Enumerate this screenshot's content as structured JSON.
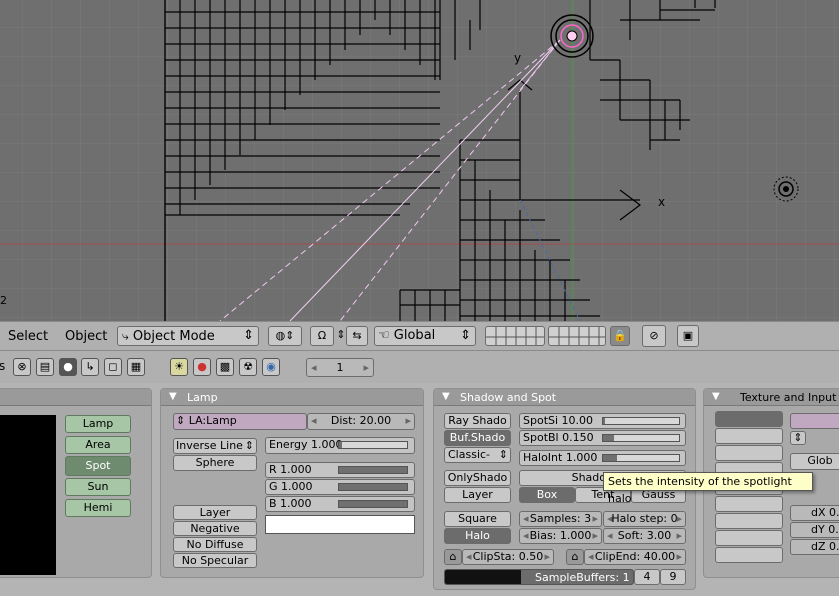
{
  "header": {
    "menus": [
      "Select",
      "Object"
    ],
    "mode": "Object Mode",
    "orientation": "Global"
  },
  "toolbar": {
    "left_fragment": "s",
    "frame": "1"
  },
  "viewport": {
    "axis_y": "y",
    "axis_x": "x",
    "corner_number": "2"
  },
  "lamp_types": [
    "Lamp",
    "Area",
    "Spot",
    "Sun",
    "Hemi"
  ],
  "lamp_panel": {
    "title": "Lamp",
    "name": "LA:Lamp",
    "dist": "Dist: 20.00",
    "inverse_line": "Inverse Line",
    "sphere": "Sphere",
    "energy": "Energy 1.000",
    "r": "R 1.000",
    "g": "G 1.000",
    "b": "B 1.000",
    "energy_level": 0.05,
    "r_level": 1.0,
    "g_level": 1.0,
    "b_level": 1.0,
    "toggles": [
      "Layer",
      "Negative",
      "No Diffuse",
      "No Specular"
    ]
  },
  "shadow_panel": {
    "title": "Shadow and Spot",
    "ray_shadow": "Ray Shado",
    "buf_shadow": "Buf.Shado",
    "classic": "Classic-",
    "only_shadow": "OnlyShado",
    "layer": "Layer",
    "square": "Square",
    "halo": "Halo",
    "spot_si": "SpotSi 10.00",
    "spot_bl": "SpotBl 0.150",
    "halo_int": "HaloInt 1.000",
    "spot_si_level": 0.02,
    "spot_bl_level": 0.15,
    "halo_int_level": 0.18,
    "shadow_buffer": "ShadowBuf",
    "filter_box": "Box",
    "filter_tent": "Tent",
    "filter_gauss": "Gauss",
    "samples": "Samples: 3",
    "halo_step": "Halo step: 0",
    "bias": "Bias: 1.000",
    "soft": "Soft: 3.00",
    "clip_sta": "ClipSta: 0.50",
    "clip_end": "ClipEnd: 40.00",
    "sample_buffers": "SampleBuffers: 1",
    "sb_4": "4",
    "sb_9": "9"
  },
  "texture_panel": {
    "title": "Texture and Input",
    "glob": "Glob",
    "dx": "dX 0.",
    "dy": "dY 0.",
    "dz": "dZ 0."
  },
  "tooltip": "Sets the intensity of the spotlight halo",
  "colors": {
    "viewport_bg": "#6f6f6f",
    "panel_bg": "#a9a9a9",
    "lamp_button": "#a6c6a6",
    "tooltip_bg": "#fefec8"
  }
}
